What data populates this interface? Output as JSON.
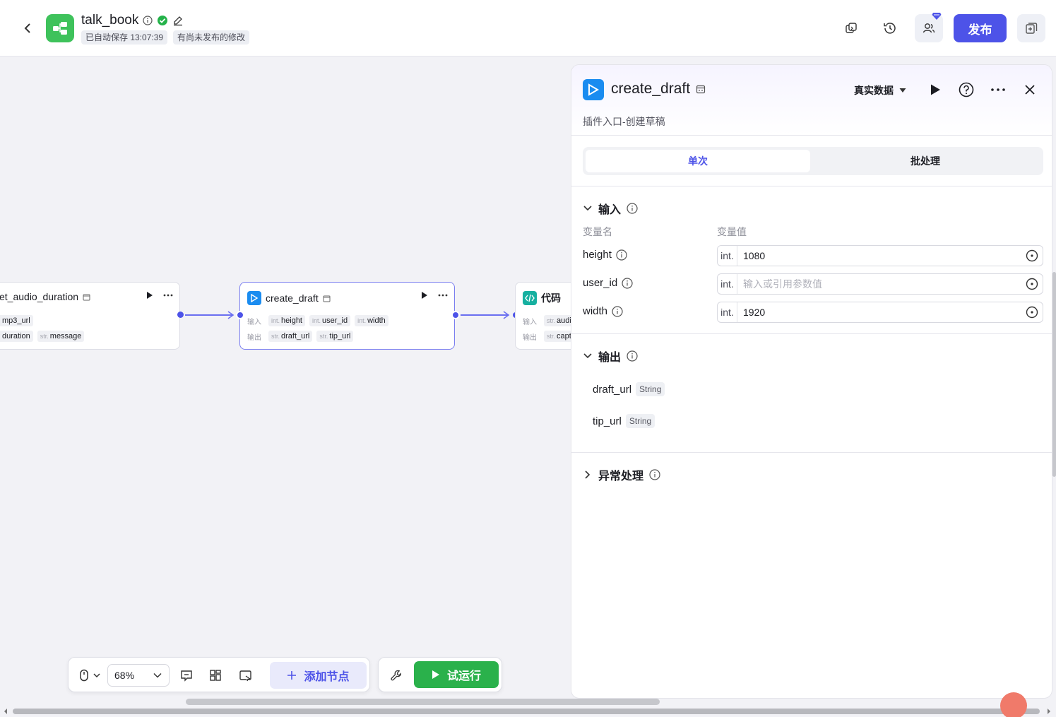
{
  "header": {
    "app_title": "talk_book",
    "autosave": "已自动保存 13:07:39",
    "unpublished": "有尚未发布的修改",
    "publish_label": "发布"
  },
  "colors": {
    "accent": "#4d53e8",
    "run_green": "#2ab14b",
    "app_icon_green": "#3ec25b"
  },
  "canvas": {
    "nodes": [
      {
        "title": "et_audio_duration",
        "input_label": "",
        "inputs": [
          {
            "type": "",
            "name": "mp3_url"
          }
        ],
        "outputs": [
          {
            "type": "",
            "name": "duration"
          },
          {
            "type": "str.",
            "name": "message"
          }
        ]
      },
      {
        "title": "create_draft",
        "input_label": "输入",
        "output_label": "输出",
        "inputs": [
          {
            "type": "int.",
            "name": "height"
          },
          {
            "type": "int.",
            "name": "user_id"
          },
          {
            "type": "int.",
            "name": "width"
          }
        ],
        "outputs": [
          {
            "type": "str.",
            "name": "draft_url"
          },
          {
            "type": "str.",
            "name": "tip_url"
          }
        ]
      },
      {
        "title": "代码",
        "input_label": "输入",
        "output_label": "输出",
        "inputs": [
          {
            "type": "str.",
            "name": "audio"
          }
        ],
        "outputs": [
          {
            "type": "str.",
            "name": "capti"
          }
        ]
      }
    ]
  },
  "toolbar": {
    "zoom": "68%",
    "add_node": "添加节点",
    "run": "试运行"
  },
  "panel": {
    "title": "create_draft",
    "data_mode": "真实数据",
    "description": "插件入口-创建草稿",
    "tabs": [
      "单次",
      "批处理"
    ],
    "input_section": "输入",
    "col_name": "变量名",
    "col_value": "变量值",
    "inputs": [
      {
        "name": "height",
        "type": "int.",
        "value": "1080",
        "placeholder": ""
      },
      {
        "name": "user_id",
        "type": "int.",
        "value": "",
        "placeholder": "输入或引用参数值"
      },
      {
        "name": "width",
        "type": "int.",
        "value": "1920",
        "placeholder": ""
      }
    ],
    "output_section": "输出",
    "outputs": [
      {
        "name": "draft_url",
        "type": "String"
      },
      {
        "name": "tip_url",
        "type": "String"
      }
    ],
    "exception_section": "异常处理"
  }
}
